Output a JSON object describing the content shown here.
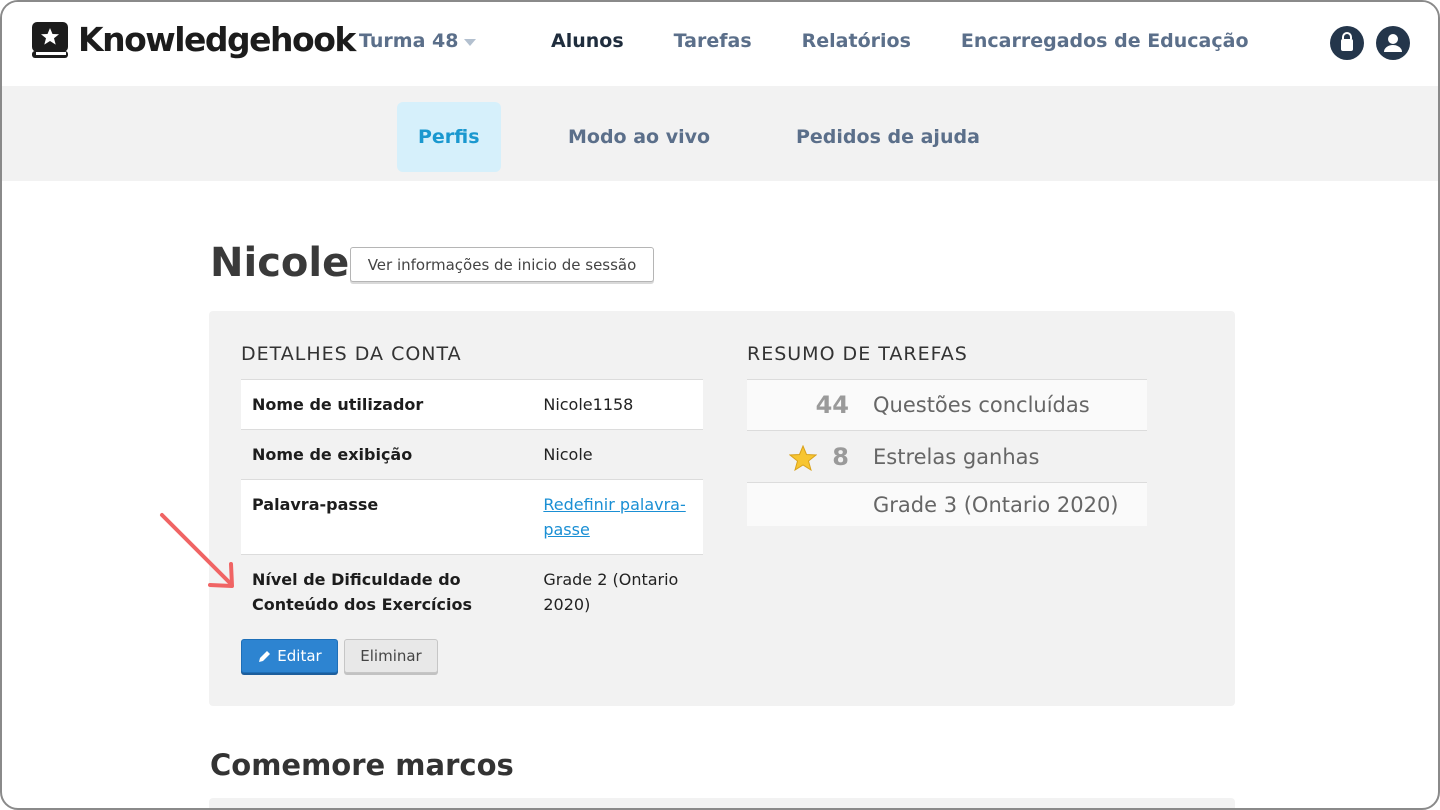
{
  "app": {
    "brand": "Knowledgehook"
  },
  "header": {
    "class_select": "Turma 48",
    "nav": [
      "Alunos",
      "Tarefas",
      "Relatórios",
      "Encarregados de Educação"
    ],
    "active_nav": "Alunos",
    "icons": [
      "bag-icon",
      "user-avatar-icon"
    ]
  },
  "subnav": {
    "tabs": [
      "Perfis",
      "Modo ao vivo",
      "Pedidos de ajuda"
    ],
    "active_tab": "Perfis"
  },
  "profile": {
    "name": "Nicole",
    "login_info_button": "Ver informações de inicio de sessão"
  },
  "account_details": {
    "title": "DETALHES DA CONTA",
    "rows": [
      {
        "label": "Nome de utilizador",
        "value": "Nicole1158"
      },
      {
        "label": "Nome de exibição",
        "value": "Nicole"
      },
      {
        "label": "Palavra-passe",
        "value": "Redefinir palavra-passe"
      },
      {
        "label": "Nível de Dificuldade do Conteúdo dos Exercícios",
        "value": "Grade 2 (Ontario 2020)"
      }
    ],
    "edit_button": "Editar",
    "delete_button": "Eliminar"
  },
  "task_summary": {
    "title": "RESUMO DE TAREFAS",
    "questions_count": "44",
    "questions_label": "Questões concluídas",
    "stars_count": "8",
    "stars_label": "Estrelas ganhas",
    "grade_label": "Grade 3 (Ontario 2020)"
  },
  "milestones": {
    "title": "Comemore marcos"
  },
  "colors": {
    "accent": "#1a98cf",
    "primary_button": "#2d84d1",
    "annotation_arrow": "#f06464",
    "nav_dark": "#24364b"
  }
}
